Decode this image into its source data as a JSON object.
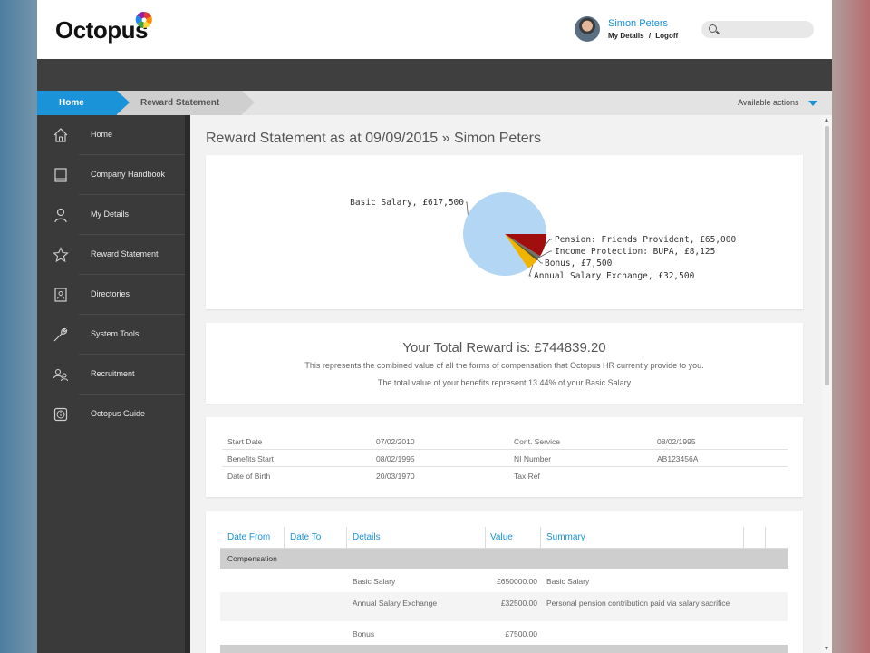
{
  "header": {
    "logo_text": "Octopus",
    "user_name": "Simon Peters",
    "my_details_link": "My Details",
    "links_separator": "/",
    "logoff_link": "Logoff",
    "search_placeholder": ""
  },
  "breadcrumb": {
    "home": "Home",
    "current": "Reward Statement",
    "actions_label": "Available actions"
  },
  "sidebar": {
    "items": [
      {
        "label": "Home",
        "icon": "home-icon"
      },
      {
        "label": "Company Handbook",
        "icon": "book-icon"
      },
      {
        "label": "My Details",
        "icon": "person-icon"
      },
      {
        "label": "Reward Statement",
        "icon": "star-icon"
      },
      {
        "label": "Directories",
        "icon": "contact-card-icon"
      },
      {
        "label": "System Tools",
        "icon": "wrench-icon"
      },
      {
        "label": "Recruitment",
        "icon": "people-icon"
      },
      {
        "label": "Octopus Guide",
        "icon": "info-icon"
      }
    ]
  },
  "main": {
    "title": "Reward Statement as at 09/09/2015 » Simon Peters"
  },
  "chart_data": {
    "type": "pie",
    "title": "",
    "slices": [
      {
        "label": "Basic Salary, £617,500",
        "value": 617500,
        "color": "#b3d6f5"
      },
      {
        "label": "Pension: Friends Provident, £65,000",
        "value": 65000,
        "color": "#a00e0e"
      },
      {
        "label": "Income Protection: BUPA, £8,125",
        "value": 8125,
        "color": "#707070"
      },
      {
        "label": "Bonus, £7,500",
        "value": 7500,
        "color": "#5a5a28"
      },
      {
        "label": "Annual Salary Exchange, £32,500",
        "value": 32500,
        "color": "#f0b400"
      }
    ]
  },
  "summary": {
    "total_title": "Your Total Reward is: £744839.20",
    "line1": "This represents the combined value of all the forms of compensation that Octopus HR currently provide to you.",
    "line2": "The total value of your benefits represent 13.44% of your Basic Salary"
  },
  "info": {
    "rows": [
      {
        "l1": "Start Date",
        "v1": "07/02/2010",
        "l2": "Cont. Service",
        "v2": "08/02/1995"
      },
      {
        "l1": "Benefits Start",
        "v1": "08/02/1995",
        "l2": "NI Number",
        "v2": "AB123456A"
      },
      {
        "l1": "Date of Birth",
        "v1": "20/03/1970",
        "l2": "Tax Ref",
        "v2": ""
      }
    ]
  },
  "table": {
    "headers": {
      "date_from": "Date From",
      "date_to": "Date To",
      "details": "Details",
      "value": "Value",
      "summary": "Summary"
    },
    "group1": "Compensation",
    "rows": [
      {
        "details": "Basic Salary",
        "value": "£650000.00",
        "summary": "Basic Salary"
      },
      {
        "details": "Annual Salary Exchange",
        "value": "£32500.00",
        "summary": "Personal pension contribution paid via salary sacrifice"
      },
      {
        "details": "Bonus",
        "value": "£7500.00",
        "summary": ""
      }
    ]
  }
}
